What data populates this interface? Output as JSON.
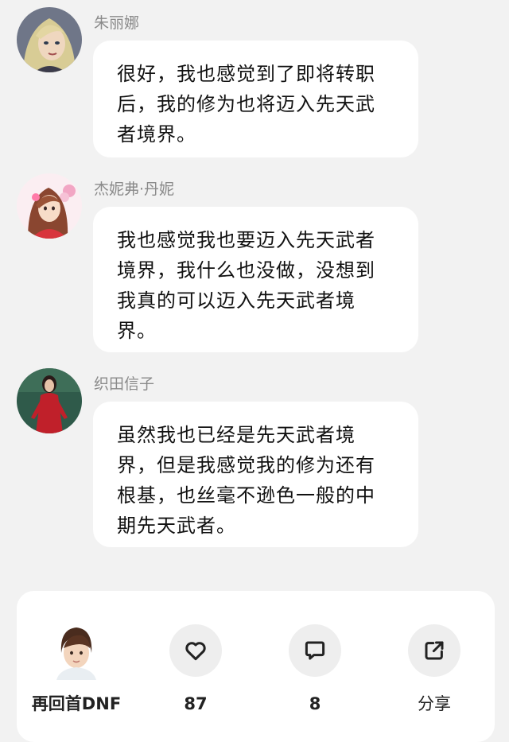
{
  "messages": [
    {
      "sender": "朱丽娜",
      "text": "很好，我也感觉到了即将转职后，我的修为也将迈入先天武者境界。",
      "avatar_icon": "blonde-woman-avatar"
    },
    {
      "sender": "杰妮弗·丹妮",
      "text": "我也感觉我也要迈入先天武者境界，我什么也没做，没想到我真的可以迈入先天武者境界。",
      "avatar_icon": "anime-girl-avatar"
    },
    {
      "sender": "织田信子",
      "text": "虽然我也已经是先天武者境界，但是我感觉我的修为还有根基，也丝毫不逊色一般的中期先天武者。",
      "avatar_icon": "woman-in-red-avatar"
    }
  ],
  "footer": {
    "author_name": "再回首DNF",
    "likes": "87",
    "comments": "8",
    "share_label": "分享",
    "icons": {
      "author": "author-avatar",
      "like": "heart-icon",
      "comment": "comment-bubble-icon",
      "share": "share-arrow-icon"
    }
  },
  "colors": {
    "page_background": "#f2f2f2",
    "bubble_background": "#ffffff",
    "sender_name": "#8a8a8a",
    "action_circle": "#eeeeee"
  }
}
